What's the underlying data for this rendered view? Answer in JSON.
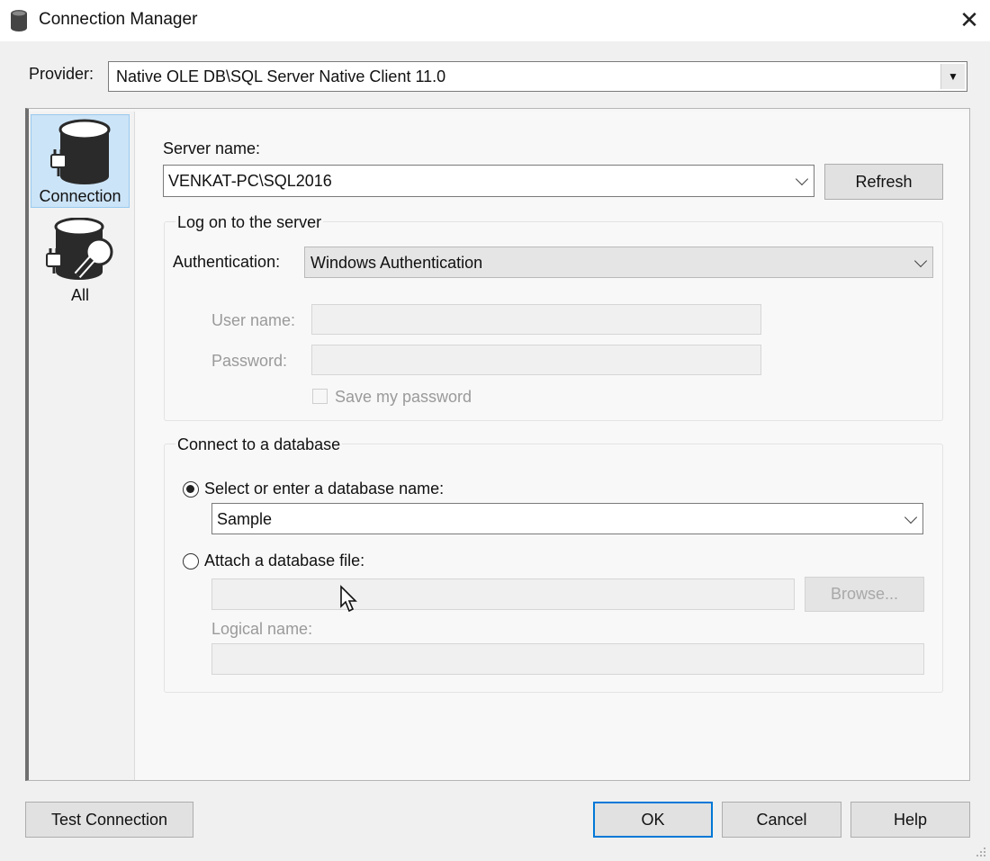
{
  "window": {
    "title": "Connection Manager",
    "close_glyph": "✕"
  },
  "provider": {
    "label": "Provider:",
    "value": "Native OLE DB\\SQL Server Native Client 11.0"
  },
  "nav": [
    {
      "label": "Connection",
      "icon": "database-plug-icon",
      "selected": true
    },
    {
      "label": "All",
      "icon": "database-wrench-icon",
      "selected": false
    }
  ],
  "server": {
    "label": "Server name:",
    "value": "VENKAT-PC\\SQL2016",
    "refresh_label": "Refresh"
  },
  "logon": {
    "group_title": "Log on to the server",
    "auth_label": "Authentication:",
    "auth_value": "Windows Authentication",
    "username_label": "User name:",
    "password_label": "Password:",
    "save_password_label": "Save my password"
  },
  "database": {
    "group_title": "Connect to a database",
    "select_option_label": "Select or enter a database name:",
    "select_value": "Sample",
    "attach_option_label": "Attach a database file:",
    "browse_label": "Browse...",
    "logical_name_label": "Logical name:"
  },
  "footer": {
    "test_label": "Test Connection",
    "ok_label": "OK",
    "cancel_label": "Cancel",
    "help_label": "Help"
  },
  "colors": {
    "selection_bg": "#cce4f7",
    "selection_border": "#99c9ef",
    "ok_border": "#0078d7"
  }
}
